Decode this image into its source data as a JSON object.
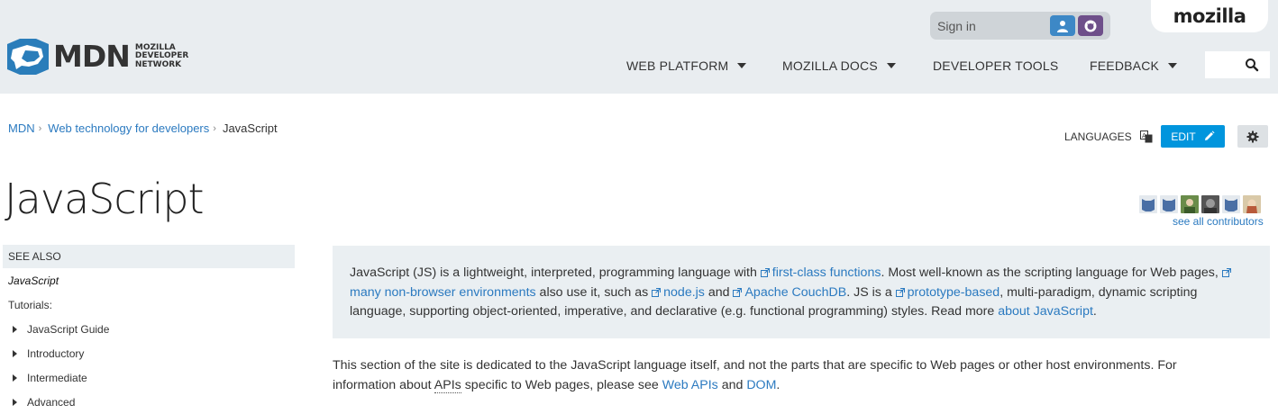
{
  "header": {
    "logo_text": "MDN",
    "logo_subtitle_lines": [
      "MOZILLA",
      "DEVELOPER",
      "NETWORK"
    ],
    "mozilla_tab": "mozilla",
    "signin_label": "Sign in",
    "nav": [
      {
        "label": "WEB PLATFORM",
        "has_dropdown": true
      },
      {
        "label": "MOZILLA DOCS",
        "has_dropdown": true
      },
      {
        "label": "DEVELOPER TOOLS",
        "has_dropdown": false
      },
      {
        "label": "FEEDBACK",
        "has_dropdown": true
      }
    ],
    "search_icon": "search-icon"
  },
  "breadcrumb": [
    {
      "label": "MDN"
    },
    {
      "label": "Web technology for developers"
    },
    {
      "label": "JavaScript"
    }
  ],
  "toolbar": {
    "languages_label": "LANGUAGES",
    "edit_label": "EDIT"
  },
  "page": {
    "title": "JavaScript",
    "see_all_contributors": "see all contributors"
  },
  "sidebar": {
    "see_also": "SEE ALSO",
    "current": "JavaScript",
    "tutorials_label": "Tutorials:",
    "items": [
      "JavaScript Guide",
      "Introductory",
      "Intermediate",
      "Advanced"
    ]
  },
  "summary": {
    "t1": "JavaScript (JS) is a lightweight, interpreted, programming language with ",
    "l1": "first-class functions",
    "t2": ". Most well-known as the scripting language for Web pages, ",
    "l2": "many non-browser environments",
    "t3": " also use it, such as ",
    "l3": "node.js",
    "t4": " and ",
    "l4": "Apache CouchDB",
    "t5": ". JS is a ",
    "l5": "prototype-based",
    "t6": ", multi-paradigm, dynamic scripting language, supporting object-oriented, imperative, and declarative (e.g. functional programming) styles. Read more ",
    "l6": "about JavaScript",
    "t7": "."
  },
  "intro": {
    "t1": "This section of the site is dedicated to the JavaScript language itself, and not the parts that are specific to Web pages or other host environments. For information about ",
    "abbr": "APIs",
    "t2": " specific to Web pages, please see ",
    "l1": "Web APIs",
    "t3": " and ",
    "l2": "DOM",
    "t4": "."
  },
  "colors": {
    "header_bg": "#e9edf0",
    "link": "#2b7ac0",
    "edit_button": "#0095dd",
    "summary_bg": "#eaeff2"
  }
}
